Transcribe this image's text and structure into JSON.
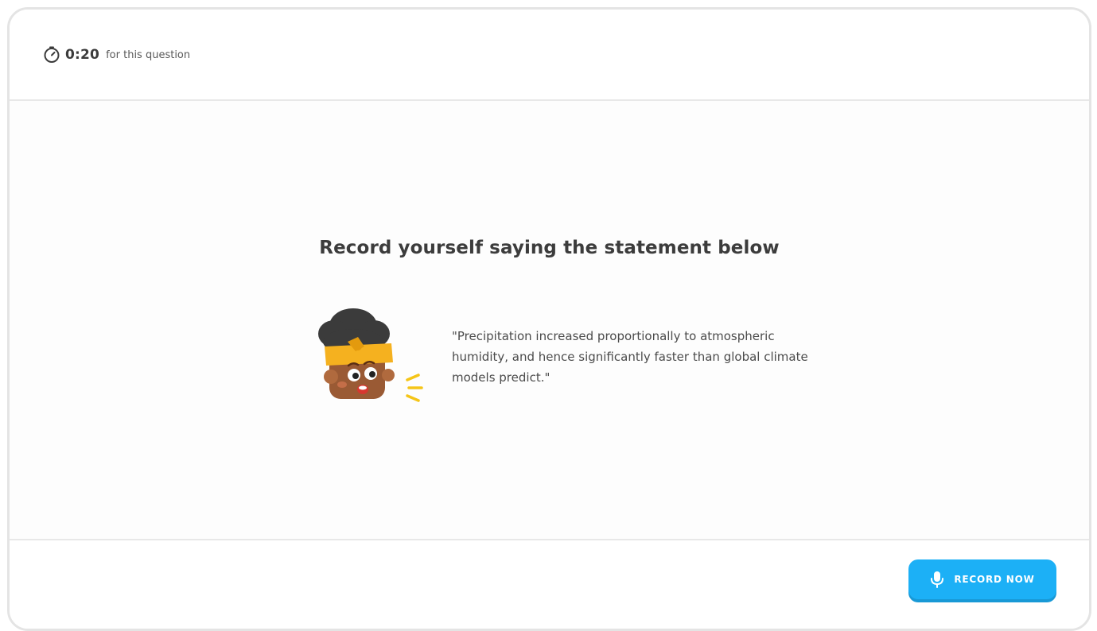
{
  "timer": {
    "time": "0:20",
    "suffix": "for this question",
    "icon": "stopwatch-icon"
  },
  "prompt": {
    "title": "Record yourself saying the statement below",
    "statement": "\"Precipitation increased proportionally to atmospheric humidity, and hence significantly faster than global climate models predict.\""
  },
  "character": {
    "icon": "speaking-character-illustration"
  },
  "actions": {
    "record_label": "RECORD NOW",
    "record_icon": "microphone-icon"
  },
  "colors": {
    "accent": "#1cb0f6",
    "accent_shadow": "#1899d6",
    "text_dark": "#3c3c3c",
    "border": "#e4e4e4"
  }
}
